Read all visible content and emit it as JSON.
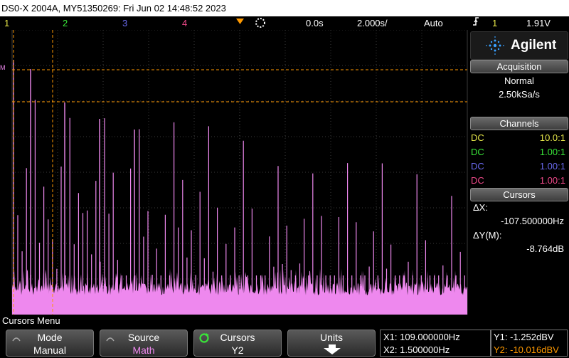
{
  "title": "DS0-X 2004A, MY51350269: Fri Jun 02 14:48:52 2023",
  "status": {
    "ch1": "1",
    "ch2": "2",
    "ch3": "3",
    "ch4": "4",
    "delay": "0.0s",
    "timebase": "2.000s/",
    "trigger_mode": "Auto",
    "trigger_source": "1",
    "trigger_level": "1.91V"
  },
  "brand": "Agilent",
  "acquisition": {
    "heading": "Acquisition",
    "mode": "Normal",
    "rate": "2.50kSa/s"
  },
  "channels": {
    "heading": "Channels",
    "items": [
      {
        "coupling": "DC",
        "ratio": "10.0:1",
        "color": "#e8e84a"
      },
      {
        "coupling": "DC",
        "ratio": "1.00:1",
        "color": "#39e639"
      },
      {
        "coupling": "DC",
        "ratio": "1.00:1",
        "color": "#6a6af0"
      },
      {
        "coupling": "DC",
        "ratio": "1.00:1",
        "color": "#f04a8a"
      }
    ]
  },
  "cursors": {
    "heading": "Cursors",
    "dx_label": "ΔX:",
    "dx_value": "-107.500000Hz",
    "dy_label": "ΔY(M):",
    "dy_value": "-8.764dB"
  },
  "menu_title": "Cursors Menu",
  "softkeys": [
    {
      "top": "Mode",
      "bottom": "Manual"
    },
    {
      "top": "Source",
      "bottom": "Math"
    },
    {
      "top": "Cursors",
      "bottom": "Y2"
    },
    {
      "top": "Units",
      "bottom": ""
    }
  ],
  "readout": {
    "x1": "X1: 109.000000Hz",
    "x2": "X2: 1.500000Hz",
    "y1": "Y1: -1.252dBV",
    "y2": "Y2: -10.016dBV"
  },
  "colors": {
    "trace": "#ee88ee",
    "cursor": "#ff9900",
    "ch1": "#e8e84a",
    "ch2": "#39e639",
    "ch3": "#6a6af0",
    "ch4": "#f04a8a"
  }
}
